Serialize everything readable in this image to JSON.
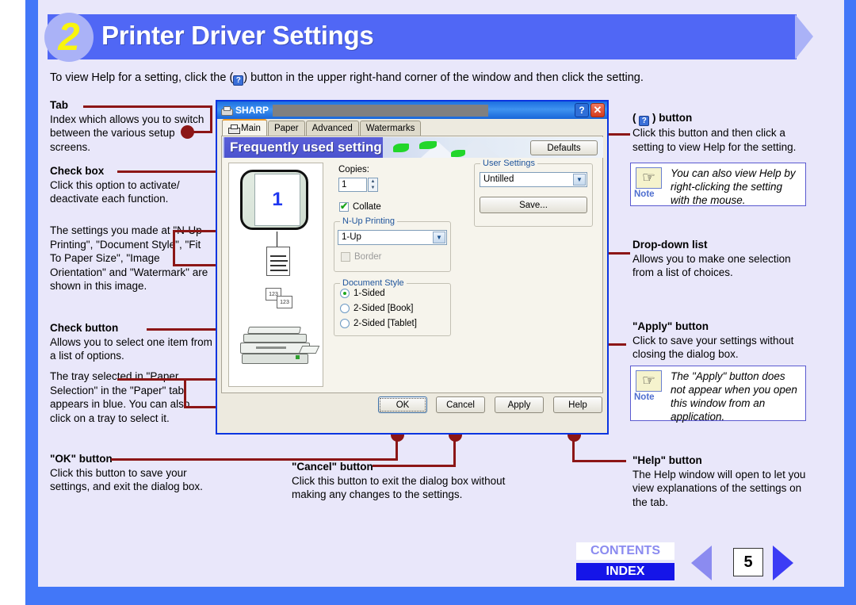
{
  "header": {
    "step_number": "2",
    "title": "Printer Driver Settings",
    "intro_before": "To view Help for a setting, click the (",
    "intro_icon": "?",
    "intro_after": ") button in the upper right-hand corner of the window and then click the setting."
  },
  "left_annotations": [
    {
      "heading": "Tab",
      "body": "Index which allows you to switch between the various setup screens."
    },
    {
      "heading": "Check box",
      "body": "Click this option to activate/ deactivate each function."
    },
    {
      "heading": "",
      "body": "The settings you made at \"N-Up Printing\", \"Document Style\", \"Fit To Paper Size\", \"Image Orientation\" and \"Watermark\" are shown in this image."
    },
    {
      "heading": "Check button",
      "body": "Allows you to select one item from a list of options."
    },
    {
      "heading": "",
      "body": "The tray selected in \"Paper Selection\" in the \"Paper\" tab appears in blue. You can also click on a tray to select it."
    },
    {
      "heading": "\"OK\" button",
      "body": "Click this button to save your settings, and exit the dialog box."
    }
  ],
  "bottom_annotation": {
    "heading": "\"Cancel\" button",
    "body": "Click this button to exit the dialog box without making any changes to the settings."
  },
  "right_annotations": [
    {
      "heading_prefix": "( ",
      "heading_icon": "?",
      "heading_suffix": " ) button",
      "body": "Click this button and then click a setting to view Help for the setting.",
      "note_label": "Note",
      "note_text": "You can also view Help by right-clicking the setting with the mouse."
    },
    {
      "heading": "Drop-down list",
      "body": "Allows you to make one selection from a list of choices."
    },
    {
      "heading": "\"Apply\" button",
      "body": "Click to save your settings without closing the dialog box.",
      "note_label": "Note",
      "note_text": "The \"Apply\" button does not appear when you open this window from an application."
    },
    {
      "heading": "\"Help\" button",
      "body": "The Help window will open to let you view explanations of the settings on the tab."
    }
  ],
  "dialog": {
    "titlebar": {
      "app_name": "SHARP",
      "help_button": "?",
      "close_button": "✕"
    },
    "tabs": [
      {
        "label": "Main",
        "active": true
      },
      {
        "label": "Paper",
        "active": false
      },
      {
        "label": "Advanced",
        "active": false
      },
      {
        "label": "Watermarks",
        "active": false
      }
    ],
    "banner_title": "Frequently used setting",
    "defaults_button": "Defaults",
    "preview_page_number": "1",
    "controls": {
      "copies_label": "Copies:",
      "copies_value": "1",
      "collate_label": "Collate",
      "collate_checked": true,
      "nup_group": "N-Up Printing",
      "nup_value": "1-Up",
      "border_label": "Border",
      "border_checked": false,
      "border_disabled": true,
      "doc_style_group": "Document Style",
      "doc_style_options": [
        {
          "label": "1-Sided",
          "selected": true
        },
        {
          "label": "2-Sided [Book]",
          "selected": false
        },
        {
          "label": "2-Sided [Tablet]",
          "selected": false
        }
      ],
      "user_settings_group": "User Settings",
      "user_settings_value": "Untilled",
      "save_button": "Save..."
    },
    "footer_buttons": [
      "OK",
      "Cancel",
      "Apply",
      "Help"
    ]
  },
  "footer_nav": {
    "contents": "CONTENTS",
    "index": "INDEX",
    "page_number": "5",
    "prev_icon": "triangle-left-icon",
    "next_icon": "triangle-right-icon"
  }
}
